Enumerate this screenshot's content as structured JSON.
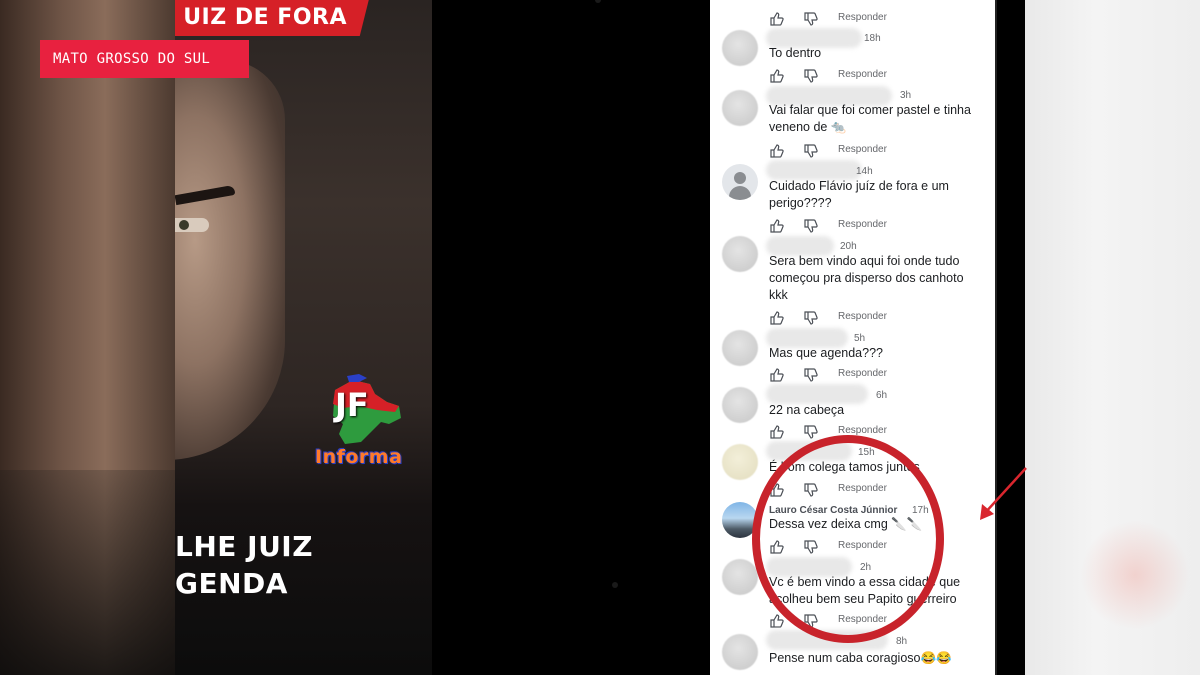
{
  "badge": {
    "label": "MATO GROSSO DO SUL"
  },
  "video": {
    "banner": "UIZ DE FORA",
    "logo_mark": "JF",
    "logo_word": "Informa",
    "caption_line1": "LHE JUIZ",
    "caption_line2": "GENDA"
  },
  "comments": {
    "reply_label": "Responder",
    "top_actions_reply": "Responder",
    "items": [
      {
        "time": "18h",
        "text": "To dentro"
      },
      {
        "time": "3h",
        "text": "Vai falar que foi comer pastel e tinha veneno de 🐀"
      },
      {
        "time": "14h",
        "text": "Cuidado Flávio juíz de fora e um perigo????"
      },
      {
        "time": "20h",
        "text": "Sera bem vindo aqui foi onde tudo começou pra disperso dos canhoto kkk"
      },
      {
        "time": "5h",
        "text": "Mas que agenda???"
      },
      {
        "time": "6h",
        "text": "22 na cabeça"
      },
      {
        "time": "15h",
        "text": "É bom colega tamos juntos"
      },
      {
        "author": "Lauro César Costa Júnnior",
        "time": "17h",
        "text": "Dessa vez deixa cmg 🔪🔪"
      },
      {
        "time": "2h",
        "text": "Vc é bem vindo a essa cidade que acolheu bem seu Papito guerreiro"
      },
      {
        "time": "8h",
        "text": "Pense num caba coragioso😂😂"
      }
    ]
  },
  "annotation": {
    "circle_color": "#c8232b",
    "arrow_color": "#d9262e"
  },
  "colors": {
    "badge_bg": "#e8213f",
    "banner_red": "#d62027",
    "informa_orange": "#ff7a2a"
  }
}
